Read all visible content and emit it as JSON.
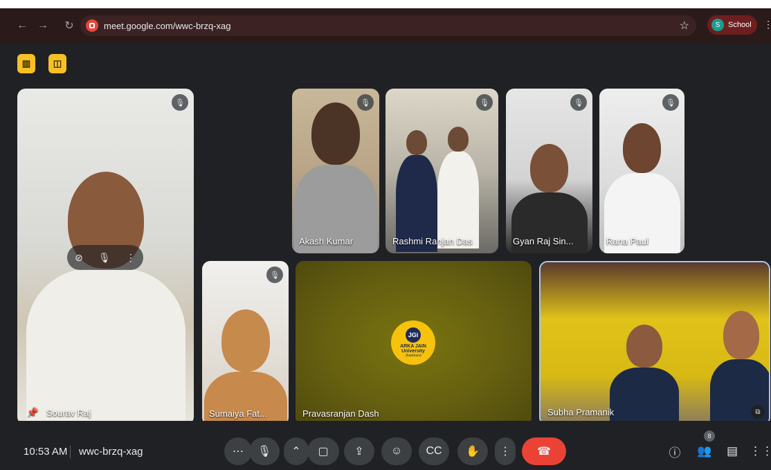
{
  "browser": {
    "url": "meet.google.com/wwc-brzq-xag",
    "profile_initial": "S",
    "profile_name": "School"
  },
  "tiles": {
    "sourav": "Sourav Raj",
    "akash": "Akash Kumar",
    "rashmi": "Rashmi Ranjan Das",
    "gyan": "Gyan Raj Sin...",
    "rana": "Rana Paul",
    "sumaiya": "Sumaiya Fat...",
    "pravas": "Pravasranjan Dash",
    "subha": "Subha Pramanik"
  },
  "logo": {
    "line1": "JGi",
    "line2": "ARKA JAIN",
    "line3": "University",
    "line4": "Jharkhand"
  },
  "bottom_bar": {
    "time": "10:53 AM",
    "meeting_code": "wwc-brzq-xag",
    "participant_count": "8"
  },
  "colors": {
    "accent_yellow": "#f6c026",
    "end_call": "#ea4335",
    "stage_bg": "#202124"
  }
}
